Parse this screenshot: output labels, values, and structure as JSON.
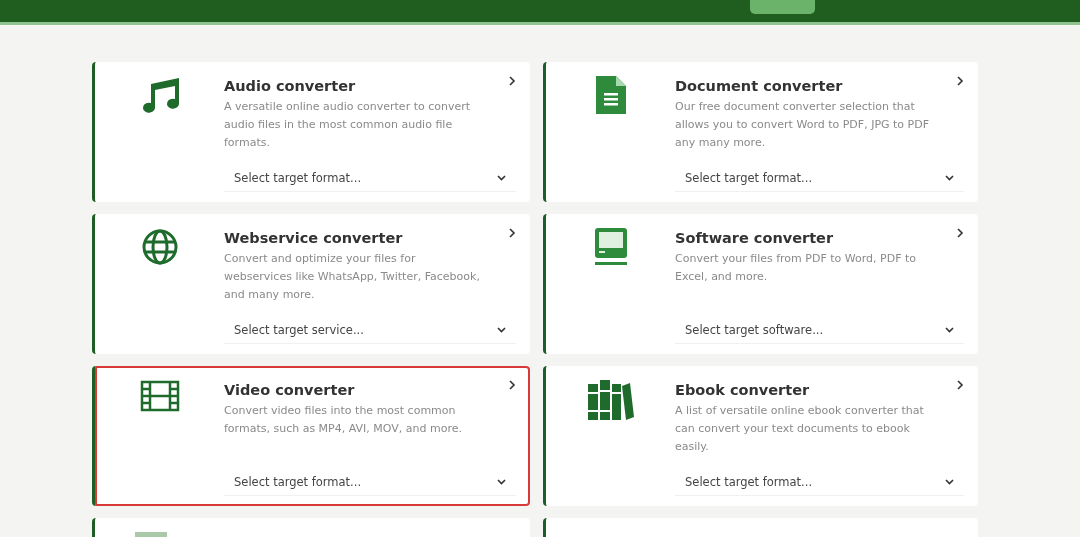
{
  "header": {
    "button": {
      "kind": "tab"
    }
  },
  "converters": [
    {
      "title": "Audio converter",
      "description": "A versatile online audio converter to convert audio files in the most common audio file formats.",
      "select_placeholder": "Select target format...",
      "highlighted": false
    },
    {
      "title": "Document converter",
      "description": "Our free document converter selection that allows you to convert Word to PDF, JPG to PDF any many more.",
      "select_placeholder": "Select target format...",
      "highlighted": false
    },
    {
      "title": "Webservice converter",
      "description": "Convert and optimize your files for webservices like WhatsApp, Twitter, Facebook, and many more.",
      "select_placeholder": "Select target service...",
      "highlighted": false
    },
    {
      "title": "Software converter",
      "description": "Convert your files from PDF to Word, PDF to Excel, and more.",
      "select_placeholder": "Select target software...",
      "highlighted": false
    },
    {
      "title": "Video converter",
      "description": "Convert video files into the most common formats, such as MP4, AVI, MOV, and more.",
      "select_placeholder": "Select target format...",
      "highlighted": true
    },
    {
      "title": "Ebook converter",
      "description": "A list of versatile online ebook converter that can convert your text documents to ebook easily.",
      "select_placeholder": "Select target format...",
      "highlighted": false
    }
  ],
  "partial_row": [
    {
      "kind": "card-with-icon"
    },
    {
      "kind": "card"
    }
  ]
}
